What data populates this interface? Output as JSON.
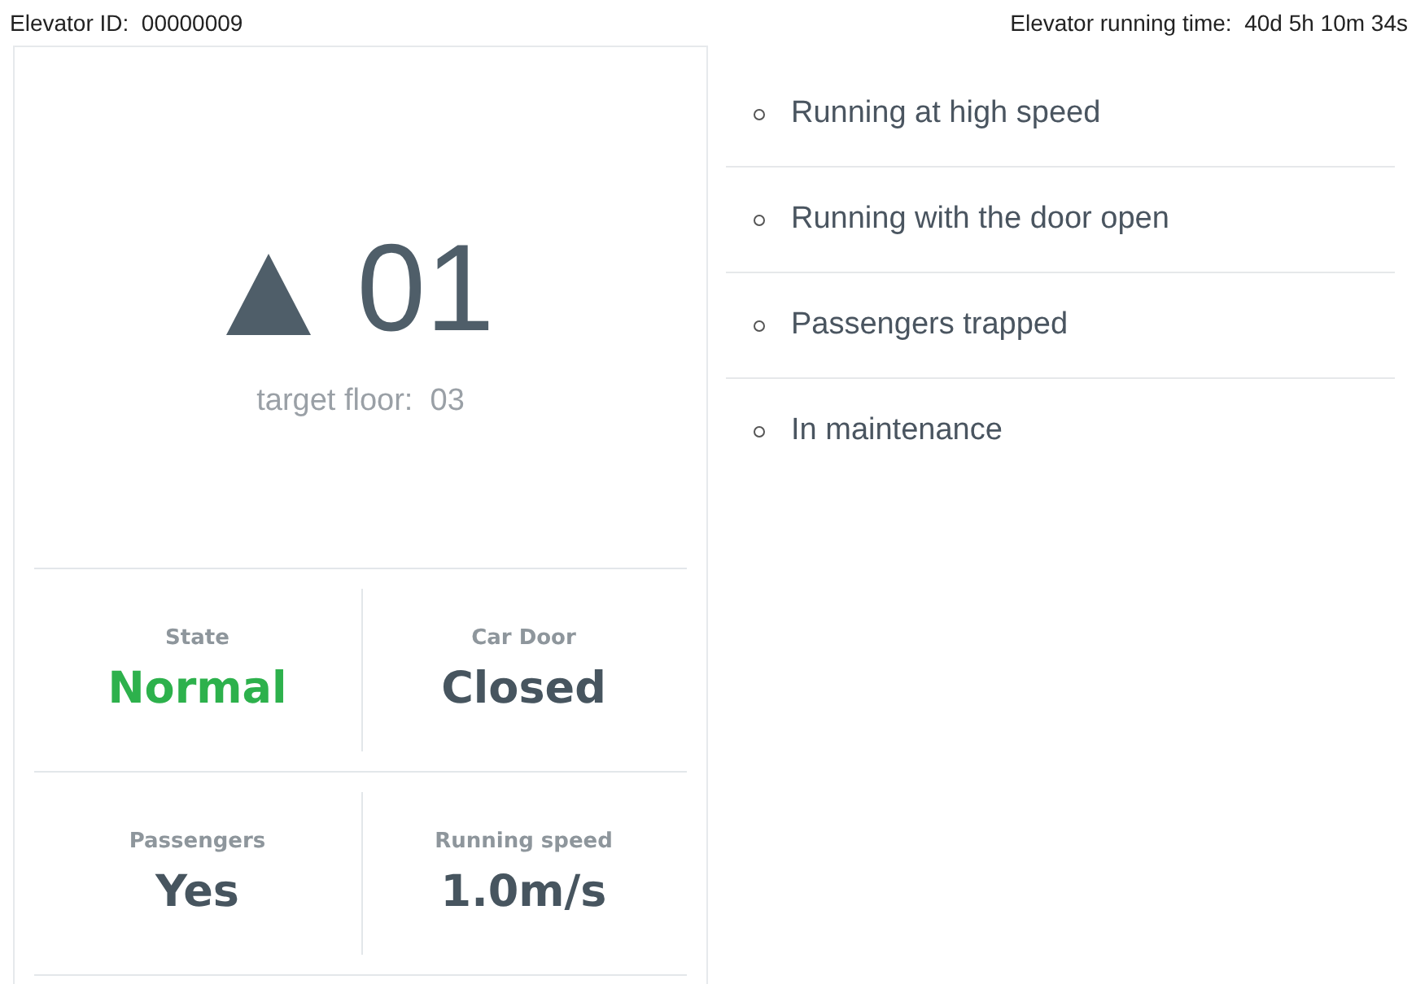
{
  "header": {
    "id_label": "Elevator ID:",
    "id_value": "00000009",
    "time_label": "Elevator running time:",
    "time_value": "40d 5h 10m 34s"
  },
  "floor": {
    "moving_up": true,
    "current": "01",
    "target_label": "target floor:",
    "target_value": "03"
  },
  "stats": [
    {
      "label": "State",
      "value": "Normal",
      "color": "#2db14c"
    },
    {
      "label": "Car Door",
      "value": "Closed",
      "color": "#47555f"
    },
    {
      "label": "Passengers",
      "value": "Yes",
      "color": "#47555f"
    },
    {
      "label": "Running speed",
      "value": "1.0m/s",
      "color": "#47555f"
    }
  ],
  "faults": [
    "Running at high speed",
    "Running with the door open",
    "Passengers trapped",
    "In maintenance"
  ]
}
